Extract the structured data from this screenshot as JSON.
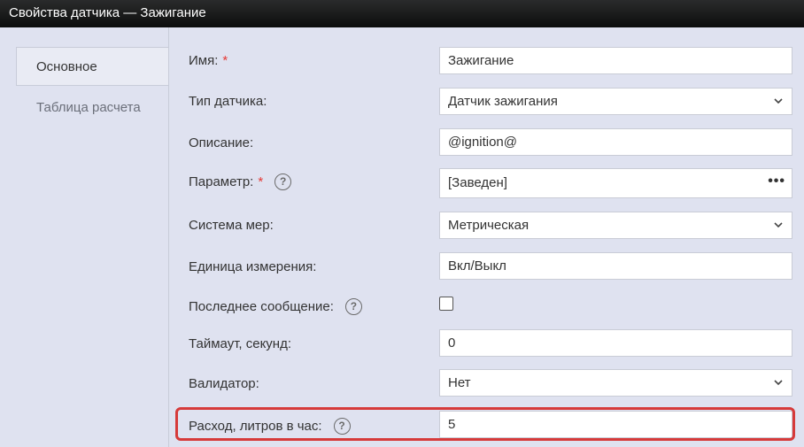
{
  "window": {
    "title": "Свойства датчика — Зажигание"
  },
  "tabs": [
    {
      "label": "Основное",
      "active": true
    },
    {
      "label": "Таблица расчета",
      "active": false
    }
  ],
  "form": {
    "name": {
      "label": "Имя:",
      "required_mark": "*",
      "value": "Зажигание"
    },
    "sensor_type": {
      "label": "Тип датчика:",
      "value": "Датчик зажигания"
    },
    "description": {
      "label": "Описание:",
      "value": "@ignition@"
    },
    "parameter": {
      "label": "Параметр:",
      "required_mark": "*",
      "help_icon": "?",
      "value": "[Заведен]",
      "more_icon": "•••"
    },
    "measure_system": {
      "label": "Система мер:",
      "value": "Метрическая"
    },
    "unit": {
      "label": "Единица измерения:",
      "value": "Вкл/Выкл"
    },
    "last_message": {
      "label": "Последнее сообщение:",
      "help_icon": "?",
      "checked": false
    },
    "timeout": {
      "label": "Таймаут, секунд:",
      "value": "0"
    },
    "validator": {
      "label": "Валидатор:",
      "value": "Нет"
    },
    "consumption": {
      "label": "Расход, литров в час:",
      "help_icon": "?",
      "value": "5"
    }
  },
  "colors": {
    "background": "#dfe2f0",
    "titlebar": "#111213",
    "required": "#e53935",
    "highlight": "#d63a3a"
  }
}
